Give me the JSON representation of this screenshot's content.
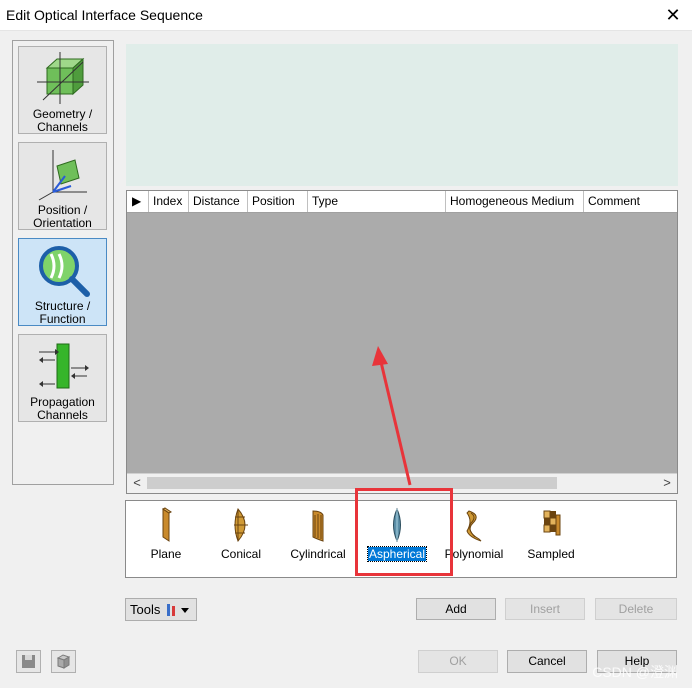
{
  "window": {
    "title": "Edit Optical Interface Sequence",
    "close_glyph": "✕"
  },
  "sidebar": {
    "items": [
      {
        "line1": "Geometry /",
        "line2": "Channels",
        "icon": "geometry-channels-icon"
      },
      {
        "line1": "Position /",
        "line2": "Orientation",
        "icon": "position-orientation-icon"
      },
      {
        "line1": "Structure /",
        "line2": "Function",
        "icon": "structure-function-icon",
        "active": true
      },
      {
        "line1": "Propagation",
        "line2": "Channels",
        "icon": "propagation-channels-icon"
      }
    ]
  },
  "grid": {
    "row_marker": "▶",
    "columns": [
      "Index",
      "Distance",
      "Position",
      "Type",
      "Homogeneous Medium",
      "Comment"
    ],
    "scroll_left": "<",
    "scroll_right": ">"
  },
  "palette": {
    "items": [
      {
        "label": "Plane",
        "icon": "plane-surface-icon"
      },
      {
        "label": "Conical",
        "icon": "conical-surface-icon"
      },
      {
        "label": "Cylindrical",
        "icon": "cylindrical-surface-icon"
      },
      {
        "label": "Aspherical",
        "icon": "aspherical-surface-icon",
        "selected": true
      },
      {
        "label": "Polynomial",
        "icon": "polynomial-surface-icon"
      },
      {
        "label": "Sampled",
        "icon": "sampled-surface-icon"
      }
    ]
  },
  "toolbar": {
    "tools_label": "Tools",
    "add_label": "Add",
    "insert_label": "Insert",
    "delete_label": "Delete"
  },
  "footer": {
    "ok_label": "OK",
    "cancel_label": "Cancel",
    "help_label": "Help"
  },
  "watermark": "CSDN @澄渊",
  "colors": {
    "selection": "#0078d7",
    "annotation": "#e8343a",
    "preview_bg": "#e0ede9",
    "grid_bg": "#ababab"
  }
}
